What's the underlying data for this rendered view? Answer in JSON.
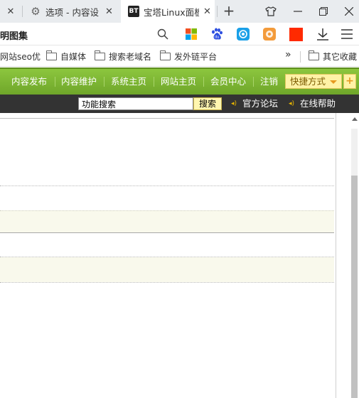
{
  "tabs": [
    {
      "title": ""
    },
    {
      "title": "选项 - 内容设"
    },
    {
      "title": "宝塔Linux面板",
      "icon_text": "BT"
    }
  ],
  "window_controls": {
    "shirt": "👕",
    "minimize": "—",
    "restore": "❐",
    "close": "✕"
  },
  "address": {
    "text": "明图集"
  },
  "toolbar_icons": [
    "search-icon",
    "windows-icon",
    "baidu-icon",
    "qiyu-icon",
    "ext-icon",
    "red-square-icon",
    "download-icon",
    "menu-icon"
  ],
  "bookmarks": {
    "items": [
      "网站seo优",
      "自媒体",
      "搜索老域名",
      "发外链平台"
    ],
    "overflow": "»",
    "other": "其它收藏"
  },
  "nav": {
    "items": [
      "内容发布",
      "内容维护",
      "系统主页",
      "网站主页",
      "会员中心",
      "注销"
    ],
    "quick": "快捷方式",
    "plus": "+"
  },
  "searchbar": {
    "input_value": "功能搜索",
    "button": "搜索",
    "links": [
      "官方论坛",
      "在线帮助"
    ]
  },
  "colors": {
    "nav_green": "#7cb832",
    "dark_bar": "#333333",
    "highlight": "#f9f9ec"
  }
}
